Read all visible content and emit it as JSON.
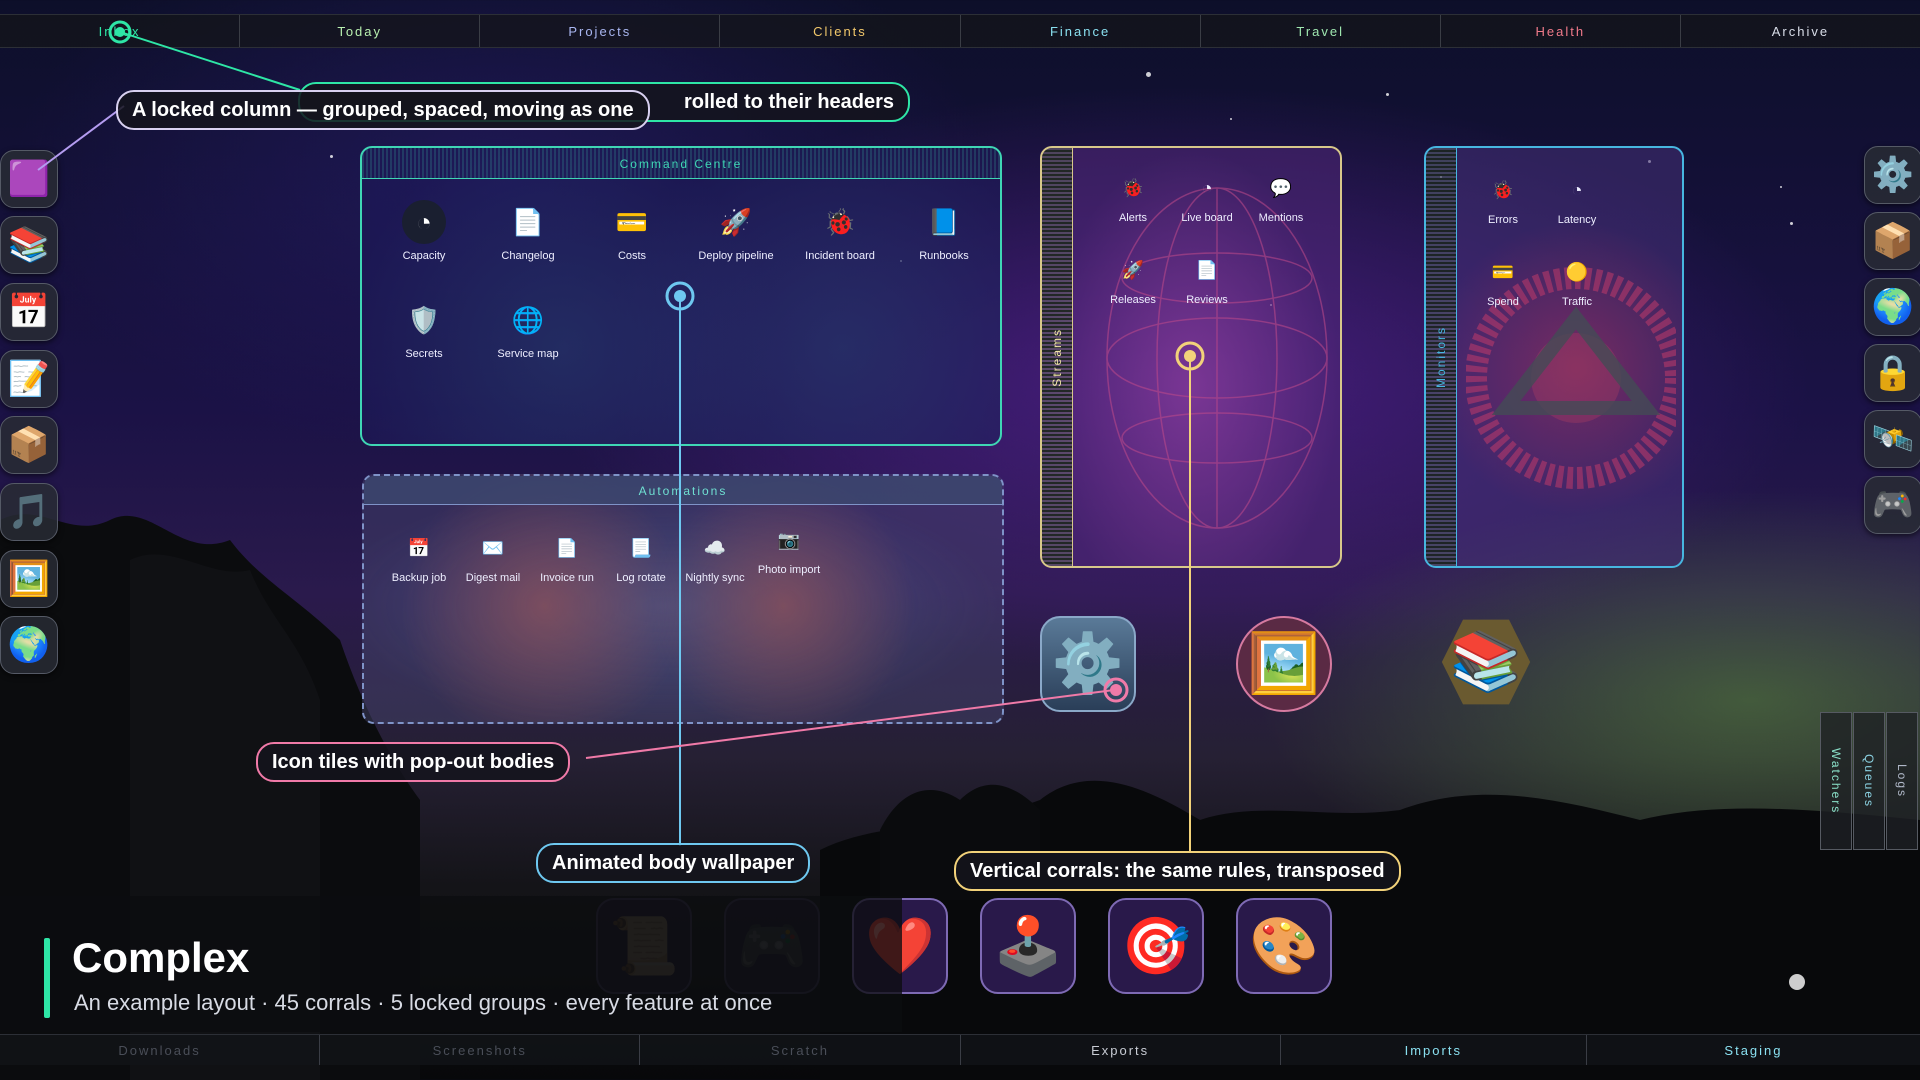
{
  "top_tabs": [
    {
      "label": "Inbox",
      "color": "#2ee6a6"
    },
    {
      "label": "Today",
      "color": "#b8f0b0"
    },
    {
      "label": "Projects",
      "color": "#a9b6f0"
    },
    {
      "label": "Clients",
      "color": "#f2c86b"
    },
    {
      "label": "Finance",
      "color": "#8ae0f0"
    },
    {
      "label": "Travel",
      "color": "#9fe7b0"
    },
    {
      "label": "Health",
      "color": "#f07a8a"
    },
    {
      "label": "Archive",
      "color": "#d8dde8"
    }
  ],
  "bottom_tabs": [
    {
      "label": "Downloads"
    },
    {
      "label": "Screenshots"
    },
    {
      "label": "Scratch"
    },
    {
      "label": "Exports"
    },
    {
      "label": "Imports"
    },
    {
      "label": "Staging"
    }
  ],
  "left_dock": [
    {
      "icon": "pixel-art-icon",
      "glyph": "🟪"
    },
    {
      "icon": "books-icon",
      "glyph": "📚"
    },
    {
      "icon": "calendar-icon",
      "glyph": "📅"
    },
    {
      "icon": "memo-icon",
      "glyph": "📝"
    },
    {
      "icon": "package-icon",
      "glyph": "📦"
    },
    {
      "icon": "music-icon",
      "glyph": "🎵"
    },
    {
      "icon": "picture-icon",
      "glyph": "🖼️"
    },
    {
      "icon": "globe-icon",
      "glyph": "🌍"
    }
  ],
  "right_dock": [
    {
      "icon": "gear-icon",
      "glyph": "⚙️"
    },
    {
      "icon": "package-icon",
      "glyph": "📦"
    },
    {
      "icon": "globe-icon",
      "glyph": "🌍"
    },
    {
      "icon": "lock-icon",
      "glyph": "🔒"
    },
    {
      "icon": "satellite-icon",
      "glyph": "🛰️"
    },
    {
      "icon": "gamepad-icon",
      "glyph": "🎮"
    }
  ],
  "command_centre": {
    "title": "Command Centre",
    "apps": [
      {
        "label": "Capacity",
        "icon": "gauge-icon",
        "glyph": "◔"
      },
      {
        "label": "Changelog",
        "icon": "document-icon",
        "glyph": "📄"
      },
      {
        "label": "Costs",
        "icon": "wallet-icon",
        "glyph": "💳"
      },
      {
        "label": "Deploy pipeline",
        "icon": "rocket-icon",
        "glyph": "🚀"
      },
      {
        "label": "Incident board",
        "icon": "bug-icon",
        "glyph": "🐞"
      },
      {
        "label": "Runbooks",
        "icon": "book-icon",
        "glyph": "📘"
      },
      {
        "label": "Secrets",
        "icon": "shield-icon",
        "glyph": "🛡️"
      },
      {
        "label": "Service map",
        "icon": "globe-icon",
        "glyph": "🌐"
      }
    ]
  },
  "automations": {
    "title": "Automations",
    "apps": [
      {
        "label": "Backup job",
        "icon": "calendar-icon",
        "glyph": "📅"
      },
      {
        "label": "Digest mail",
        "icon": "mail-icon",
        "glyph": "✉️"
      },
      {
        "label": "Invoice run",
        "icon": "document-icon",
        "glyph": "📄"
      },
      {
        "label": "Log rotate",
        "icon": "log-icon",
        "glyph": "📃"
      },
      {
        "label": "Nightly sync",
        "icon": "cloud-icon",
        "glyph": "☁️"
      },
      {
        "label": "Photo import",
        "icon": "camera-icon",
        "glyph": "📷"
      }
    ]
  },
  "streams": {
    "title": "Streams",
    "apps": [
      {
        "label": "Alerts",
        "icon": "bug-icon",
        "glyph": "🐞"
      },
      {
        "label": "Live board",
        "icon": "gauge-icon",
        "glyph": "◔"
      },
      {
        "label": "Mentions",
        "icon": "chat-icon",
        "glyph": "💬"
      },
      {
        "label": "Releases",
        "icon": "rocket-icon",
        "glyph": "🚀"
      },
      {
        "label": "Reviews",
        "icon": "document-icon",
        "glyph": "📄"
      }
    ]
  },
  "monitors": {
    "title": "Monitors",
    "apps": [
      {
        "label": "Errors",
        "icon": "bug-icon",
        "glyph": "🐞"
      },
      {
        "label": "Latency",
        "icon": "gauge-icon",
        "glyph": "◔"
      },
      {
        "label": "Spend",
        "icon": "wallet-icon",
        "glyph": "💳"
      },
      {
        "label": "Traffic",
        "icon": "traffic-icon",
        "glyph": "🟡"
      }
    ]
  },
  "free_tiles": [
    {
      "icon": "gear-icon",
      "glyph": "⚙️"
    },
    {
      "icon": "picture-icon",
      "glyph": "🖼️"
    },
    {
      "icon": "books-icon",
      "glyph": "📚"
    }
  ],
  "bottom_tiles": [
    {
      "icon": "scroll-icon",
      "glyph": "📜"
    },
    {
      "icon": "gamepad-icon",
      "glyph": "🎮"
    },
    {
      "icon": "heart-icon",
      "glyph": "❤️"
    },
    {
      "icon": "joystick-icon",
      "glyph": "🕹️"
    },
    {
      "icon": "target-icon",
      "glyph": "🎯"
    },
    {
      "icon": "palette-icon",
      "glyph": "🎨"
    }
  ],
  "side_tabs": [
    "Watchers",
    "Queues",
    "Logs"
  ],
  "callouts": {
    "locked_column": "A locked column — grouped, spaced, moving as one",
    "rolled": "rolled to their headers",
    "icon_tiles": "Icon tiles with pop-out bodies",
    "wallpaper": "Animated body wallpaper",
    "vertical": "Vertical corrals: the same rules, transposed"
  },
  "title_panel": {
    "title": "Complex",
    "subtitle": "An example layout · 45 corrals · 5 locked groups · every feature at once",
    "accent": "#2ee6a6"
  }
}
